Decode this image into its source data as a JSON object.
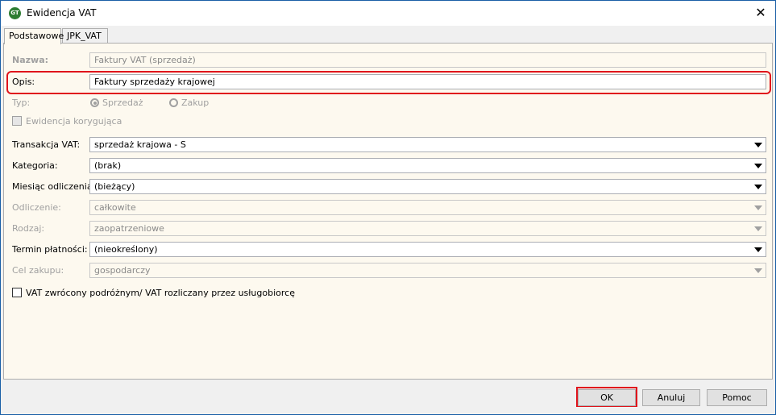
{
  "window": {
    "title": "Ewidencja VAT",
    "close": "✕",
    "title_bar_color": "#ffffff",
    "highlight_color": "#e0141c"
  },
  "tabs": [
    {
      "label": "Podstawowe",
      "active": true
    },
    {
      "label": "JPK_VAT",
      "active": false
    }
  ],
  "form": {
    "nazwa": {
      "label": "Nazwa:",
      "value": "Faktury VAT (sprzedaż)"
    },
    "opis": {
      "label": "Opis:",
      "value": "Faktury sprzedaży krajowej"
    },
    "typ": {
      "label": "Typ:",
      "options": [
        "Sprzedaż",
        "Zakup"
      ],
      "selected": "Sprzedaż"
    },
    "korygujaca": {
      "label": "Ewidencja korygująca",
      "checked": false
    },
    "transakcja": {
      "label": "Transakcja VAT:",
      "value": "sprzedaż krajowa - S"
    },
    "kategoria": {
      "label": "Kategoria:",
      "value": "(brak)"
    },
    "miesiac": {
      "label": "Miesiąc odliczenia:",
      "value": "(bieżący)"
    },
    "odliczenie": {
      "label": "Odliczenie:",
      "value": "całkowite"
    },
    "rodzaj": {
      "label": "Rodzaj:",
      "value": "zaopatrzeniowe"
    },
    "termin": {
      "label": "Termin płatności:",
      "value": "(nieokreślony)"
    },
    "cel": {
      "label": "Cel zakupu:",
      "value": "gospodarczy"
    },
    "vat_zwrocony": {
      "label": "VAT zwrócony podróżnym/ VAT rozliczany przez usługobiorcę",
      "checked": false
    }
  },
  "buttons": {
    "ok": "OK",
    "cancel": "Anuluj",
    "help": "Pomoc"
  }
}
